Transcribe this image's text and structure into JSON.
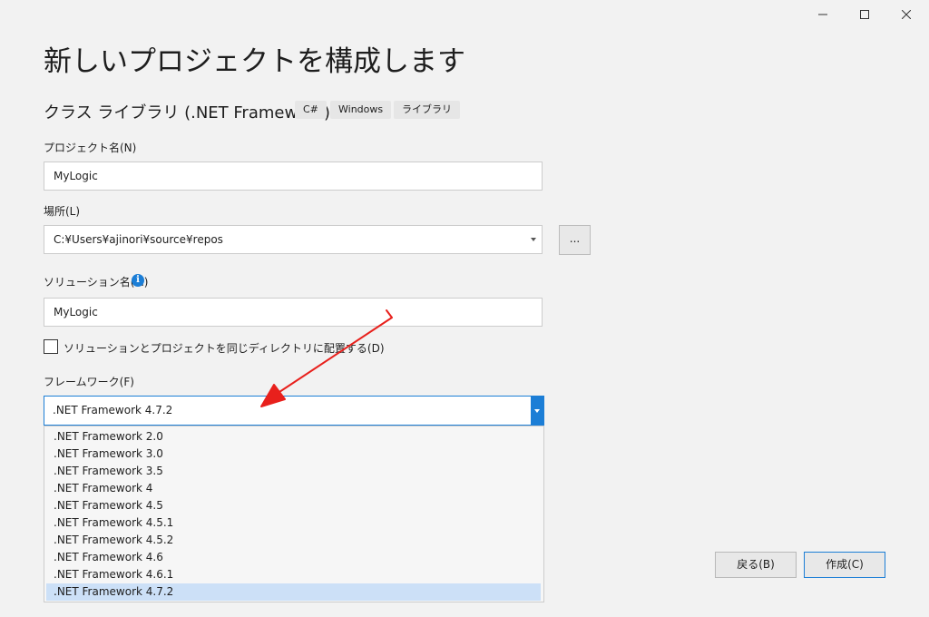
{
  "heading": "新しいプロジェクトを構成します",
  "template": {
    "name": "クラス ライブラリ (.NET Framework)",
    "tags": [
      "C#",
      "Windows",
      "ライブラリ"
    ]
  },
  "project_name": {
    "label": "プロジェクト名(N)",
    "value": "MyLogic"
  },
  "location": {
    "label": "場所(L)",
    "value": "C:¥Users¥ajinori¥source¥repos",
    "browse_label": "..."
  },
  "solution_name": {
    "label": "ソリューション名(M)",
    "value": "MyLogic",
    "info_icon": "i"
  },
  "same_dir_checkbox": {
    "label": "ソリューションとプロジェクトを同じディレクトリに配置する(D)",
    "checked": false
  },
  "framework": {
    "label": "フレームワーク(F)",
    "selected": ".NET Framework 4.7.2",
    "options": [
      ".NET Framework 2.0",
      ".NET Framework 3.0",
      ".NET Framework 3.5",
      ".NET Framework 4",
      ".NET Framework 4.5",
      ".NET Framework 4.5.1",
      ".NET Framework 4.5.2",
      ".NET Framework 4.6",
      ".NET Framework 4.6.1",
      ".NET Framework 4.7.2"
    ]
  },
  "buttons": {
    "back": "戻る(B)",
    "create": "作成(C)"
  },
  "colors": {
    "accent": "#1c7ed6",
    "annotation_arrow": "#e8201c",
    "selected_option": "#cce0f7"
  },
  "icons": [
    "minimize-icon",
    "maximize-icon",
    "close-icon",
    "info-icon",
    "chevron-down-icon",
    "annotation-arrow"
  ]
}
